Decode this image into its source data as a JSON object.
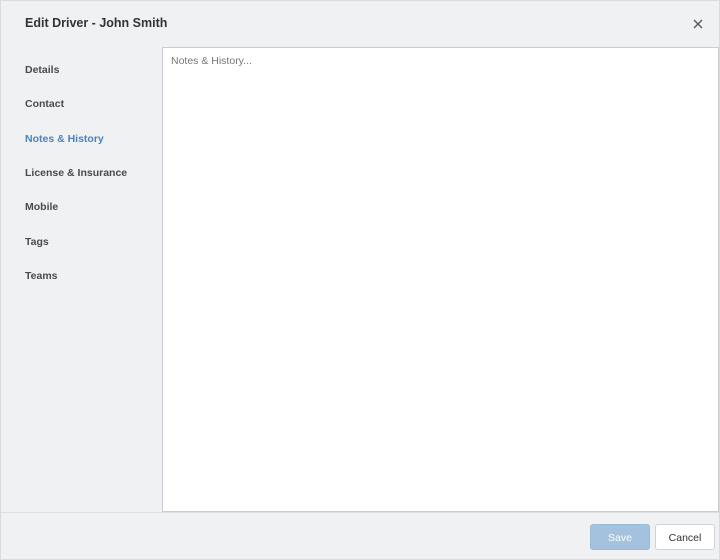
{
  "dialog": {
    "title": "Edit Driver - John Smith",
    "close_icon": "close-icon"
  },
  "sidebar": {
    "items": [
      {
        "label": "Details",
        "active": false
      },
      {
        "label": "Contact",
        "active": false
      },
      {
        "label": "Notes & History",
        "active": true
      },
      {
        "label": "License & Insurance",
        "active": false
      },
      {
        "label": "Mobile",
        "active": false
      },
      {
        "label": "Tags",
        "active": false
      },
      {
        "label": "Teams",
        "active": false
      }
    ]
  },
  "main": {
    "notes": {
      "value": "",
      "placeholder": "Notes & History..."
    }
  },
  "footer": {
    "save_label": "Save",
    "save_disabled": true,
    "cancel_label": "Cancel"
  },
  "colors": {
    "accent": "#4a83bd",
    "save_button_disabled": "#a4c2de",
    "panel_background": "#f0f1f3"
  }
}
